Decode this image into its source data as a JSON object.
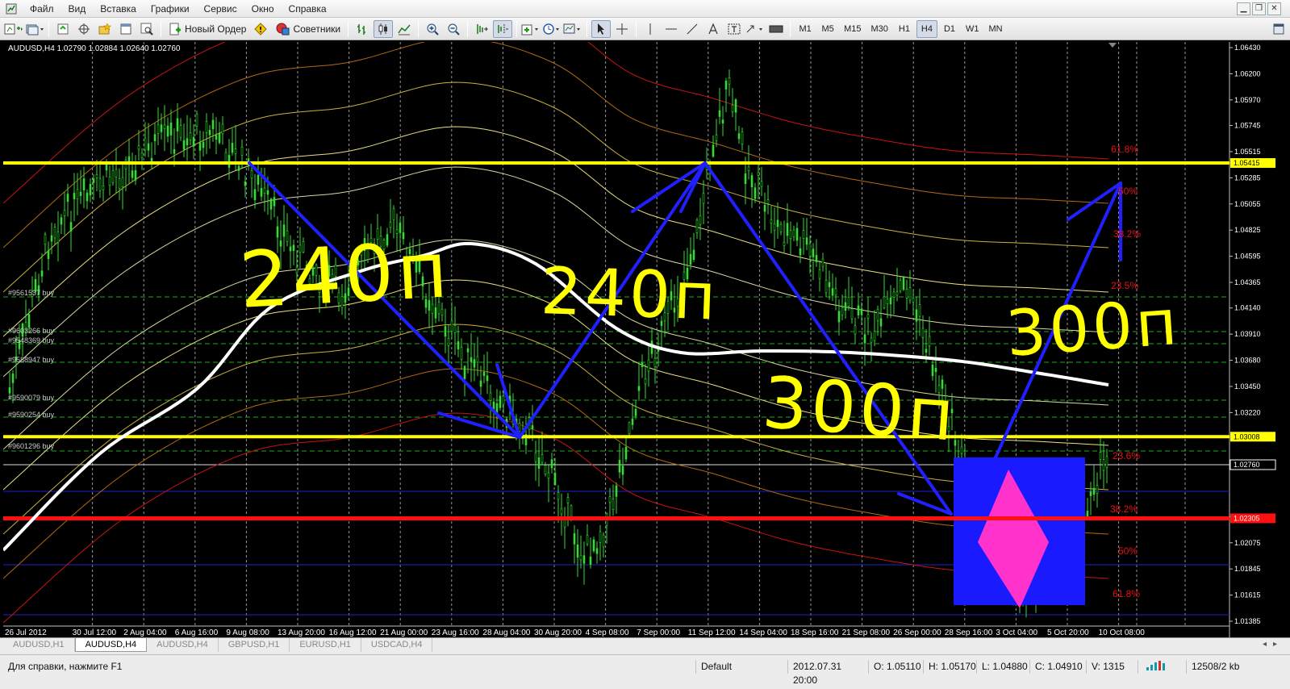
{
  "menu": {
    "items": [
      "Файл",
      "Вид",
      "Вставка",
      "Графики",
      "Сервис",
      "Окно",
      "Справка"
    ]
  },
  "toolbar": {
    "new_order_label": "Новый Ордер",
    "experts_label": "Советники",
    "timeframes": [
      "M1",
      "M5",
      "M15",
      "M30",
      "H1",
      "H4",
      "D1",
      "W1",
      "MN"
    ],
    "active_timeframe": "H4"
  },
  "chart": {
    "header": "AUDUSD,H4  1.02790 1.02884 1.02640 1.02760",
    "price_labels": [
      "1.06430",
      "1.06200",
      "1.05970",
      "1.05745",
      "1.05515",
      "1.05415",
      "1.05285",
      "1.05055",
      "1.04825",
      "1.04595",
      "1.04365",
      "1.04140",
      "1.03910",
      "1.03680",
      "1.03450",
      "1.03220",
      "1.03008",
      "1.02760",
      "1.02305",
      "1.02075",
      "1.01845",
      "1.01615",
      "1.01385"
    ],
    "date_labels": [
      "26 Jul 2012",
      "30 Jul 12:00",
      "2 Aug 04:00",
      "6 Aug 16:00",
      "9 Aug 08:00",
      "13 Aug 20:00",
      "16 Aug 12:00",
      "21 Aug 00:00",
      "23 Aug 16:00",
      "28 Aug 04:00",
      "30 Aug 20:00",
      "4 Sep 08:00",
      "7 Sep 00:00",
      "11 Sep 12:00",
      "14 Sep 04:00",
      "18 Sep 16:00",
      "21 Sep 08:00",
      "26 Sep 00:00",
      "28 Sep 16:00",
      "3 Oct 04:00",
      "5 Oct 20:00",
      "10 Oct 08:00"
    ],
    "orders": [
      "#9561537 buy",
      "#9603266 buy",
      "#9548369 buy",
      "#9588947 buy",
      "#9590079 buy",
      "#9590254 buy",
      "#9601296 buy"
    ],
    "fib_labels": [
      "61.8%",
      "50%",
      "38.2%",
      "23.5%",
      "23.6%",
      "38.2%",
      "50%",
      "61.8%"
    ],
    "annotations": [
      "240п",
      "240п",
      "300п",
      "300п"
    ],
    "levels": {
      "upper_yellow": 1.05415,
      "lower_yellow": 1.03008,
      "red": 1.0229
    },
    "colors": {
      "yellow_level": "#ffff00",
      "red_level": "#ff1010",
      "candles": "#33dd33",
      "trend_lines": "#2020ff",
      "ma_line": "#ffffff",
      "box": "#1a1aff",
      "diamond": "#ff33cc"
    }
  },
  "tabs": {
    "items": [
      "AUDUSD,H1",
      "AUDUSD,H4",
      "AUDUSD,H4",
      "GBPUSD,H1",
      "EURUSD,H1",
      "USDCAD,H4"
    ],
    "active_index": 1
  },
  "status": {
    "help": "Для справки, нажмите F1",
    "profile": "Default",
    "datetime": "2012.07.31 20:00",
    "open": "O: 1.05110",
    "high": "H: 1.05170",
    "low": "L: 1.04880",
    "close": "C: 1.04910",
    "volume": "V: 1315",
    "traffic": "12508/2 kb"
  }
}
